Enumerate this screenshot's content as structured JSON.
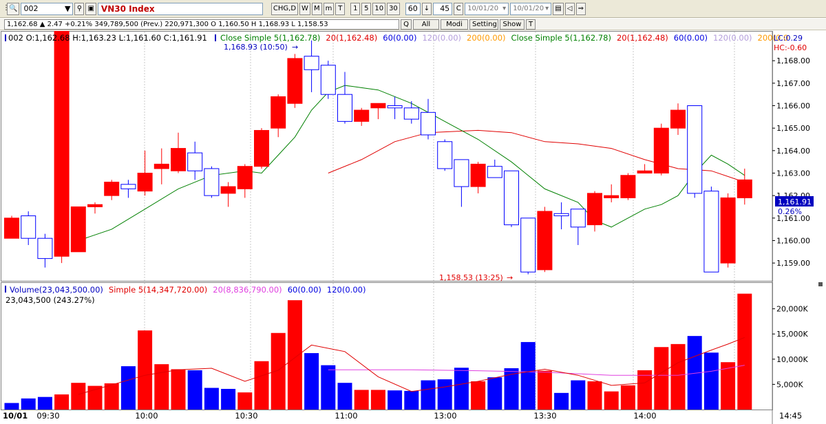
{
  "toolbar": {
    "symbol_code": "002",
    "symbol_name": "VN30 Index",
    "chart_type_label": "CHG,D",
    "period_buttons": [
      "W",
      "M",
      "m",
      "T"
    ],
    "minute_buttons": [
      "1",
      "5",
      "10",
      "30"
    ],
    "interval_value": "60",
    "count_value": "45",
    "c_label": "C",
    "date_from": "10/01/20",
    "date_to": "10/01/20"
  },
  "infobar": {
    "quote_text": "1,162.68 ▲ 2.47 +0.21% 349,789,500 (Prev.) 220,971,300 O 1,160.50 H 1,168.93 L 1,158.53",
    "buttons": [
      "Q",
      "All",
      "Modi",
      "Setting",
      "Show",
      "T"
    ]
  },
  "price_panel": {
    "ohlc_label": "002 O:1,162.68 H:1,163.23 L:1,161.60 C:1,161.91",
    "legend": [
      {
        "text": "Close Simple 5(1,162.78)",
        "color": "#008000"
      },
      {
        "text": "20(1,162.48)",
        "color": "#e00000"
      },
      {
        "text": "60(0.00)",
        "color": "#0000e0"
      },
      {
        "text": "120(0.00)",
        "color": "#b39ddb"
      },
      {
        "text": "200(0.00)",
        "color": "#ff9900"
      },
      {
        "text": "Close Simple 5(1,162.78)",
        "color": "#008000"
      },
      {
        "text": "20(1,162.48)",
        "color": "#e00000"
      },
      {
        "text": "60(0.00)",
        "color": "#0000e0"
      },
      {
        "text": "120(0.00)",
        "color": "#b39ddb"
      },
      {
        "text": "200(0.0",
        "color": "#ff9900"
      }
    ],
    "lc_label": "LC:0.29",
    "hc_label": "HC:-0.60",
    "high_marker": "1,168.93 (10:50)",
    "low_marker": "1,158.53 (13:25)",
    "current_price": "1,161.91",
    "current_pct": "0.26%",
    "y_ticks": [
      "1,168.00",
      "1,167.00",
      "1,166.00",
      "1,165.00",
      "1,164.00",
      "1,163.00",
      "1,162.00",
      "1,161.00",
      "1,160.00",
      "1,159.00"
    ]
  },
  "volume_panel": {
    "legend": [
      {
        "text": "Volume(23,043,500.00)",
        "color": "#0000c0"
      },
      {
        "text": "Simple 5(14,347,720.00)",
        "color": "#e00000"
      },
      {
        "text": "20(8,836,790.00)",
        "color": "#e040e0"
      },
      {
        "text": "60(0.00)",
        "color": "#0000e0"
      },
      {
        "text": "120(0.00)",
        "color": "#0000e0"
      }
    ],
    "value_label": "23,043,500 (243.27%)",
    "y_ticks": [
      "20,000K",
      "15,000K",
      "10,000K",
      "5,000K"
    ]
  },
  "time_axis": {
    "date_label": "10/01",
    "labels": [
      "09:30",
      "10:00",
      "10:30",
      "11:00",
      "13:00",
      "13:30",
      "14:00"
    ],
    "end_label": "14:45"
  },
  "chart_data": {
    "type": "candlestick",
    "price_ylim": [
      1158.3,
      1169.2
    ],
    "volume_ylim": [
      0,
      23500000
    ],
    "candles": [
      {
        "o": 1161.0,
        "h": 1161.1,
        "l": 1160.2,
        "c": 1160.1,
        "up": true
      },
      {
        "o": 1160.1,
        "h": 1161.3,
        "l": 1159.8,
        "c": 1161.1,
        "up": false
      },
      {
        "o": 1160.1,
        "h": 1160.3,
        "l": 1158.8,
        "c": 1159.2,
        "up": false
      },
      {
        "o": 1159.3,
        "h": 1159.6,
        "l": 1159.0,
        "c": 1459.1,
        "up": true
      },
      {
        "o": 1159.5,
        "h": 1161.5,
        "l": 1159.5,
        "c": 1161.5,
        "up": true
      },
      {
        "o": 1161.5,
        "h": 1161.7,
        "l": 1161.2,
        "c": 1161.6,
        "up": true
      },
      {
        "o": 1162.0,
        "h": 1162.7,
        "l": 1161.8,
        "c": 1162.6,
        "up": true
      },
      {
        "o": 1162.5,
        "h": 1162.7,
        "l": 1161.9,
        "c": 1162.3,
        "up": false
      },
      {
        "o": 1162.2,
        "h": 1164.0,
        "l": 1162.0,
        "c": 1163.0,
        "up": true
      },
      {
        "o": 1163.2,
        "h": 1164.1,
        "l": 1162.5,
        "c": 1163.4,
        "up": true
      },
      {
        "o": 1163.1,
        "h": 1164.8,
        "l": 1163.0,
        "c": 1164.1,
        "up": true
      },
      {
        "o": 1163.9,
        "h": 1164.4,
        "l": 1162.7,
        "c": 1163.1,
        "up": false
      },
      {
        "o": 1163.2,
        "h": 1163.3,
        "l": 1161.9,
        "c": 1162.0,
        "up": false
      },
      {
        "o": 1162.4,
        "h": 1162.6,
        "l": 1161.5,
        "c": 1162.1,
        "up": true
      },
      {
        "o": 1162.3,
        "h": 1163.4,
        "l": 1161.9,
        "c": 1163.3,
        "up": true
      },
      {
        "o": 1163.3,
        "h": 1165.0,
        "l": 1163.2,
        "c": 1164.9,
        "up": true
      },
      {
        "o": 1165.0,
        "h": 1166.5,
        "l": 1164.6,
        "c": 1166.4,
        "up": true
      },
      {
        "o": 1166.1,
        "h": 1168.3,
        "l": 1165.9,
        "c": 1168.1,
        "up": true
      },
      {
        "o": 1167.6,
        "h": 1168.9,
        "l": 1166.6,
        "c": 1168.2,
        "up": false
      },
      {
        "o": 1166.5,
        "h": 1168.0,
        "l": 1166.3,
        "c": 1167.8,
        "up": false
      },
      {
        "o": 1165.3,
        "h": 1167.5,
        "l": 1165.2,
        "c": 1166.5,
        "up": false
      },
      {
        "o": 1165.3,
        "h": 1165.9,
        "l": 1165.1,
        "c": 1165.8,
        "up": true
      },
      {
        "o": 1165.9,
        "h": 1166.1,
        "l": 1165.4,
        "c": 1166.1,
        "up": true
      },
      {
        "o": 1166.0,
        "h": 1166.4,
        "l": 1165.4,
        "c": 1165.9,
        "up": false
      },
      {
        "o": 1165.4,
        "h": 1166.2,
        "l": 1165.2,
        "c": 1165.9,
        "up": false
      },
      {
        "o": 1164.7,
        "h": 1166.3,
        "l": 1164.5,
        "c": 1165.7,
        "up": false
      },
      {
        "o": 1163.2,
        "h": 1164.5,
        "l": 1163.1,
        "c": 1164.4,
        "up": false
      },
      {
        "o": 1162.4,
        "h": 1163.5,
        "l": 1161.5,
        "c": 1163.6,
        "up": false
      },
      {
        "o": 1162.4,
        "h": 1163.5,
        "l": 1162.1,
        "c": 1163.4,
        "up": true
      },
      {
        "o": 1162.8,
        "h": 1163.6,
        "l": 1162.8,
        "c": 1163.3,
        "up": false
      },
      {
        "o": 1160.7,
        "h": 1163.1,
        "l": 1160.6,
        "c": 1163.1,
        "up": false
      },
      {
        "o": 1158.6,
        "h": 1161.0,
        "l": 1158.5,
        "c": 1161.0,
        "up": false
      },
      {
        "o": 1158.7,
        "h": 1161.5,
        "l": 1158.6,
        "c": 1161.3,
        "up": true
      },
      {
        "o": 1161.2,
        "h": 1161.7,
        "l": 1160.5,
        "c": 1161.1,
        "up": false
      },
      {
        "o": 1160.6,
        "h": 1161.4,
        "l": 1159.8,
        "c": 1161.4,
        "up": false
      },
      {
        "o": 1160.7,
        "h": 1162.2,
        "l": 1160.4,
        "c": 1162.1,
        "up": true
      },
      {
        "o": 1162.0,
        "h": 1162.5,
        "l": 1161.7,
        "c": 1161.9,
        "up": true
      },
      {
        "o": 1161.9,
        "h": 1163.0,
        "l": 1161.8,
        "c": 1162.9,
        "up": true
      },
      {
        "o": 1163.1,
        "h": 1163.4,
        "l": 1163.0,
        "c": 1163.0,
        "up": true
      },
      {
        "o": 1163.0,
        "h": 1165.2,
        "l": 1162.9,
        "c": 1165.0,
        "up": true
      },
      {
        "o": 1165.0,
        "h": 1166.1,
        "l": 1164.7,
        "c": 1165.8,
        "up": true
      },
      {
        "o": 1162.1,
        "h": 1166.0,
        "l": 1161.9,
        "c": 1166.0,
        "up": false
      },
      {
        "o": 1158.6,
        "h": 1162.4,
        "l": 1158.6,
        "c": 1162.2,
        "up": false
      },
      {
        "o": 1159.0,
        "h": 1162.1,
        "l": 1158.8,
        "c": 1161.9,
        "up": true
      },
      {
        "o": 1161.9,
        "h": 1163.2,
        "l": 1161.6,
        "c": 1162.7,
        "up": true
      }
    ],
    "volume": [
      {
        "v": 1300000,
        "up": false
      },
      {
        "v": 2200000,
        "up": false
      },
      {
        "v": 2500000,
        "up": false
      },
      {
        "v": 3000000,
        "up": true
      },
      {
        "v": 5300000,
        "up": true
      },
      {
        "v": 4700000,
        "up": true
      },
      {
        "v": 5200000,
        "up": true
      },
      {
        "v": 8600000,
        "up": false
      },
      {
        "v": 15700000,
        "up": true
      },
      {
        "v": 9000000,
        "up": true
      },
      {
        "v": 8000000,
        "up": true
      },
      {
        "v": 7800000,
        "up": false
      },
      {
        "v": 4300000,
        "up": false
      },
      {
        "v": 4100000,
        "up": false
      },
      {
        "v": 3400000,
        "up": true
      },
      {
        "v": 9600000,
        "up": true
      },
      {
        "v": 15200000,
        "up": true
      },
      {
        "v": 21700000,
        "up": true
      },
      {
        "v": 11200000,
        "up": false
      },
      {
        "v": 8800000,
        "up": false
      },
      {
        "v": 5300000,
        "up": false
      },
      {
        "v": 3900000,
        "up": true
      },
      {
        "v": 3900000,
        "up": true
      },
      {
        "v": 3800000,
        "up": false
      },
      {
        "v": 3700000,
        "up": false
      },
      {
        "v": 5800000,
        "up": false
      },
      {
        "v": 6000000,
        "up": false
      },
      {
        "v": 8300000,
        "up": false
      },
      {
        "v": 5600000,
        "up": true
      },
      {
        "v": 6400000,
        "up": false
      },
      {
        "v": 8200000,
        "up": false
      },
      {
        "v": 13400000,
        "up": false
      },
      {
        "v": 7700000,
        "up": true
      },
      {
        "v": 3300000,
        "up": false
      },
      {
        "v": 5800000,
        "up": false
      },
      {
        "v": 5600000,
        "up": true
      },
      {
        "v": 3600000,
        "up": true
      },
      {
        "v": 4800000,
        "up": true
      },
      {
        "v": 7800000,
        "up": true
      },
      {
        "v": 12400000,
        "up": true
      },
      {
        "v": 13000000,
        "up": true
      },
      {
        "v": 14600000,
        "up": false
      },
      {
        "v": 11300000,
        "up": false
      },
      {
        "v": 9400000,
        "up": true
      },
      {
        "v": 23000000,
        "up": true
      }
    ],
    "ma5": [
      {
        "i": 4,
        "v": 1160.0
      },
      {
        "i": 6,
        "v": 1160.5
      },
      {
        "i": 8,
        "v": 1161.4
      },
      {
        "i": 10,
        "v": 1162.3
      },
      {
        "i": 12,
        "v": 1162.9
      },
      {
        "i": 14,
        "v": 1163.1
      },
      {
        "i": 15,
        "v": 1163.0
      },
      {
        "i": 16,
        "v": 1163.8
      },
      {
        "i": 17,
        "v": 1164.6
      },
      {
        "i": 18,
        "v": 1165.8
      },
      {
        "i": 19,
        "v": 1166.6
      },
      {
        "i": 20,
        "v": 1166.9
      },
      {
        "i": 22,
        "v": 1166.7
      },
      {
        "i": 24,
        "v": 1166.1
      },
      {
        "i": 26,
        "v": 1165.3
      },
      {
        "i": 28,
        "v": 1164.5
      },
      {
        "i": 30,
        "v": 1163.5
      },
      {
        "i": 32,
        "v": 1162.3
      },
      {
        "i": 34,
        "v": 1161.7
      },
      {
        "i": 35,
        "v": 1160.9
      },
      {
        "i": 36,
        "v": 1160.6
      },
      {
        "i": 37,
        "v": 1161.0
      },
      {
        "i": 38,
        "v": 1161.4
      },
      {
        "i": 39,
        "v": 1161.6
      },
      {
        "i": 40,
        "v": 1162.0
      },
      {
        "i": 41,
        "v": 1163.0
      },
      {
        "i": 42,
        "v": 1163.8
      },
      {
        "i": 43,
        "v": 1163.4
      },
      {
        "i": 44,
        "v": 1162.9
      }
    ],
    "ma20": [
      {
        "i": 19,
        "v": 1163.0
      },
      {
        "i": 21,
        "v": 1163.6
      },
      {
        "i": 23,
        "v": 1164.4
      },
      {
        "i": 25,
        "v": 1164.8
      },
      {
        "i": 28,
        "v": 1164.9
      },
      {
        "i": 30,
        "v": 1164.8
      },
      {
        "i": 32,
        "v": 1164.4
      },
      {
        "i": 34,
        "v": 1164.3
      },
      {
        "i": 36,
        "v": 1164.1
      },
      {
        "i": 38,
        "v": 1163.6
      },
      {
        "i": 40,
        "v": 1163.2
      },
      {
        "i": 42,
        "v": 1163.1
      },
      {
        "i": 44,
        "v": 1162.6
      }
    ],
    "vol_ma5": [
      {
        "i": 4,
        "v": 3000000
      },
      {
        "i": 8,
        "v": 6800000
      },
      {
        "i": 10,
        "v": 7900000
      },
      {
        "i": 12,
        "v": 8200000
      },
      {
        "i": 14,
        "v": 5600000
      },
      {
        "i": 16,
        "v": 7800000
      },
      {
        "i": 18,
        "v": 12800000
      },
      {
        "i": 20,
        "v": 11500000
      },
      {
        "i": 22,
        "v": 6500000
      },
      {
        "i": 24,
        "v": 3600000
      },
      {
        "i": 26,
        "v": 4500000
      },
      {
        "i": 28,
        "v": 5600000
      },
      {
        "i": 30,
        "v": 7000000
      },
      {
        "i": 32,
        "v": 8000000
      },
      {
        "i": 34,
        "v": 6800000
      },
      {
        "i": 36,
        "v": 4800000
      },
      {
        "i": 38,
        "v": 5300000
      },
      {
        "i": 40,
        "v": 9300000
      },
      {
        "i": 42,
        "v": 11800000
      },
      {
        "i": 43,
        "v": 13000000
      },
      {
        "i": 44,
        "v": 14300000
      }
    ],
    "vol_ma20": [
      {
        "i": 19,
        "v": 7900000
      },
      {
        "i": 24,
        "v": 7900000
      },
      {
        "i": 28,
        "v": 7700000
      },
      {
        "i": 32,
        "v": 7400000
      },
      {
        "i": 36,
        "v": 6800000
      },
      {
        "i": 40,
        "v": 6800000
      },
      {
        "i": 42,
        "v": 7600000
      },
      {
        "i": 44,
        "v": 8800000
      }
    ]
  },
  "colors": {
    "up": "#ff0000",
    "down": "#0000ff",
    "ma5": "#008000",
    "ma20": "#e00000",
    "vol_ma20": "#e040e0"
  }
}
